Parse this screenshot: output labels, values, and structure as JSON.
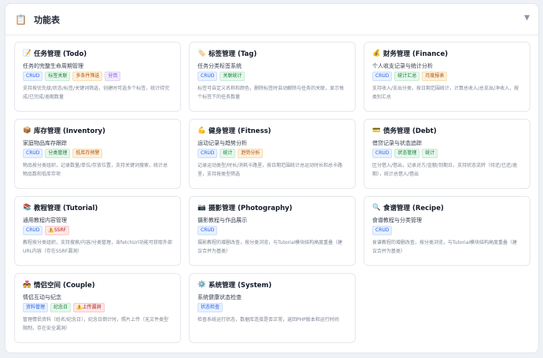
{
  "header": {
    "title": "功能表",
    "icon": "clipboard-icon",
    "chevron": "▼"
  },
  "colors": {
    "blue": "#2563eb",
    "green": "#15803d",
    "orange": "#b45309",
    "purple": "#7c3aed",
    "red": "#b91c1c"
  },
  "cards": [
    {
      "id": "todo",
      "icon": "📝",
      "icon_name": "memo-icon",
      "title": "任务管理 (Todo)",
      "subtitle": "任务的完整生命周期管理",
      "tags": [
        {
          "label": "CRUD",
          "color": "blue"
        },
        {
          "label": "标签关联",
          "color": "green"
        },
        {
          "label": "多条件筛选",
          "color": "orange"
        },
        {
          "label": "分页",
          "color": "purple"
        }
      ],
      "desc": "支持按优先级/状态/标签/关键词筛选，创建时可选多个标签，统计待完成/已完成/逾期数量"
    },
    {
      "id": "tag",
      "icon": "🏷️",
      "icon_name": "label-icon",
      "title": "标签管理 (Tag)",
      "subtitle": "任务分类标签系统",
      "tags": [
        {
          "label": "CRUD",
          "color": "blue"
        },
        {
          "label": "关联统计",
          "color": "green"
        }
      ],
      "desc": "标签可自定义名称和颜色，删除标签时自动解除与任务的关联，显示每个标签下的任务数量"
    },
    {
      "id": "finance",
      "icon": "💰",
      "icon_name": "money-bag-icon",
      "title": "财务管理 (Finance)",
      "subtitle": "个人收支记录与统计分析",
      "tags": [
        {
          "label": "CRUD",
          "color": "blue"
        },
        {
          "label": "统计汇总",
          "color": "green"
        },
        {
          "label": "月度报表",
          "color": "orange"
        }
      ],
      "desc": "支持收入/支出分类，按日期范围统计，计算总收入/总支出/净收入，按类别汇总"
    },
    {
      "id": "inventory",
      "icon": "📦",
      "icon_name": "package-icon",
      "title": "库存管理 (Inventory)",
      "subtitle": "家庭物品库存跟踪",
      "tags": [
        {
          "label": "CRUD",
          "color": "blue"
        },
        {
          "label": "分类管理",
          "color": "green"
        },
        {
          "label": "低库存预警",
          "color": "orange"
        }
      ],
      "desc": "物品按分类组织，记录数量/单位/存放位置，支持关键词搜索，统计总物品数和低库存项"
    },
    {
      "id": "fitness",
      "icon": "💪",
      "icon_name": "flexed-biceps-icon",
      "title": "健身管理 (Fitness)",
      "subtitle": "运动记录与趋势分析",
      "tags": [
        {
          "label": "CRUD",
          "color": "blue"
        },
        {
          "label": "统计",
          "color": "green"
        },
        {
          "label": "趋势分析",
          "color": "orange"
        }
      ],
      "desc": "记录运动类型/时长/消耗卡路里，按日期范围统计总运动时长和总卡路里，支持按类型筛选"
    },
    {
      "id": "debt",
      "icon": "💳",
      "icon_name": "credit-card-icon",
      "title": "债务管理 (Debt)",
      "subtitle": "借贷记录与状态追踪",
      "tags": [
        {
          "label": "CRUD",
          "color": "blue"
        },
        {
          "label": "状态管理",
          "color": "green"
        },
        {
          "label": "统计",
          "color": "green"
        }
      ],
      "desc": "区分借入/借出，记录对方/金额/到期日，支持状态流转（待还/已还/逾期），统计总借入/借出"
    },
    {
      "id": "tutorial",
      "icon": "📚",
      "icon_name": "books-icon",
      "title": "教程管理 (Tutorial)",
      "subtitle": "通用教程内容管理",
      "tags": [
        {
          "label": "CRUD",
          "color": "blue"
        },
        {
          "label": "⚠️SSRF",
          "color": "red"
        }
      ],
      "desc": "教程按分类组织，支持搜索/内容/分类管理，含fetchUrl功能可获取外部URL内容（存在SSRF漏洞）"
    },
    {
      "id": "photography",
      "icon": "📷",
      "icon_name": "camera-icon",
      "title": "摄影管理 (Photography)",
      "subtitle": "摄影教程与作品展示",
      "tags": [
        {
          "label": "CRUD",
          "color": "blue"
        }
      ],
      "desc": "摄影教程的增删改查，按分类浏览，与Tutorial模块结构高度重叠（建议合并为基类）"
    },
    {
      "id": "recipe",
      "icon": "🔍",
      "icon_name": "magnifier-icon",
      "title": "食谱管理 (Recipe)",
      "subtitle": "食谱教程与分类管理",
      "tags": [
        {
          "label": "CRUD",
          "color": "blue"
        }
      ],
      "desc": "食谱教程的增删改查，按分类浏览，与Tutorial模块结构高度重叠（建议合并为基类）"
    },
    {
      "id": "couple",
      "icon": "💑",
      "icon_name": "couple-icon",
      "title": "情侣空间 (Couple)",
      "subtitle": "情侣互动与纪念",
      "tags": [
        {
          "label": "资料管理",
          "color": "blue"
        },
        {
          "label": "纪念日",
          "color": "green"
        },
        {
          "label": "⚠️上传漏洞",
          "color": "red"
        }
      ],
      "desc": "管理情侣资料（姓名/纪念日），纪念日倒计时，照片上传（无文件类型限制，存在安全漏洞）"
    },
    {
      "id": "system",
      "icon": "⚙️",
      "icon_name": "gear-icon",
      "title": "系统管理 (System)",
      "subtitle": "系统健康状态检查",
      "tags": [
        {
          "label": "状态检查",
          "color": "blue"
        }
      ],
      "desc": "检查系统运行状态，数据库连接是否正常，返回PHP版本和运行时间"
    }
  ]
}
